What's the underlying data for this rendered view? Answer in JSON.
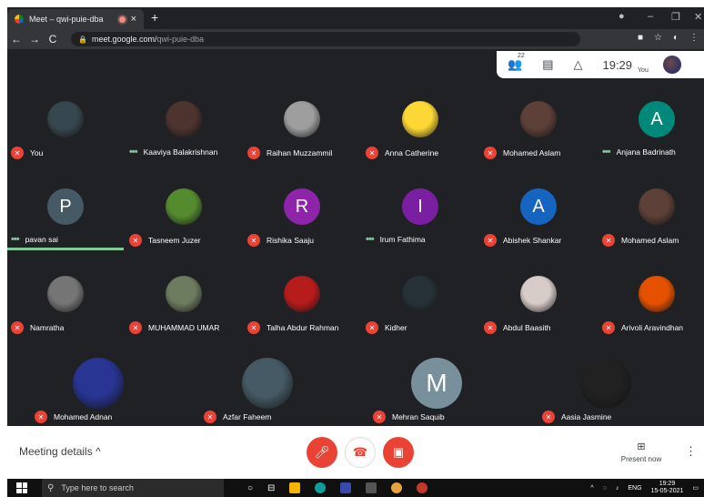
{
  "browser": {
    "tab_title": "Meet – qwi-puie-dba",
    "tab_close": "×",
    "new_tab": "+",
    "url_host": "meet.google.com/",
    "url_path": "qwi-puie-dba",
    "back": "←",
    "forward": "→",
    "reload": "C",
    "minimize": "–",
    "restore": "❐",
    "close": "✕"
  },
  "meet": {
    "participants_count": "22",
    "time": "19:29",
    "you_label": "You",
    "participants": [
      {
        "name": "You",
        "status": "muted",
        "kind": "photo",
        "color": "#37474f"
      },
      {
        "name": "Kaaviya Balakrishnan",
        "status": "speaking",
        "kind": "photo",
        "color": "#4e342e"
      },
      {
        "name": "Raihan Muzzammil",
        "status": "muted",
        "kind": "photo",
        "color": "#9e9e9e"
      },
      {
        "name": "Anna Catherine",
        "status": "muted",
        "kind": "photo",
        "color": "#fdd835"
      },
      {
        "name": "Mohamed Aslam",
        "status": "muted",
        "kind": "photo",
        "color": "#5d4037"
      },
      {
        "name": "Anjana Badrinath",
        "status": "speaking",
        "kind": "letter",
        "letter": "A",
        "color": "#00897b"
      },
      {
        "name": "pavan sai",
        "status": "speaking",
        "kind": "letter",
        "letter": "P",
        "color": "#455a64"
      },
      {
        "name": "Tasneem Juzer",
        "status": "muted",
        "kind": "photo",
        "color": "#558b2f"
      },
      {
        "name": "Rishika Saaju",
        "status": "muted",
        "kind": "letter",
        "letter": "R",
        "color": "#8e24aa"
      },
      {
        "name": "Irum Fathima",
        "status": "speaking",
        "kind": "letter",
        "letter": "I",
        "color": "#7b1fa2"
      },
      {
        "name": "Abishek Shankar",
        "status": "muted",
        "kind": "letter",
        "letter": "A",
        "color": "#1565c0"
      },
      {
        "name": "Mohamed Aslam",
        "status": "muted",
        "kind": "photo",
        "color": "#5d4037"
      },
      {
        "name": "Namratha",
        "status": "muted",
        "kind": "photo",
        "color": "#757575"
      },
      {
        "name": "MUHAMMAD UMAR",
        "status": "muted",
        "kind": "photo",
        "color": "#6d7b5f"
      },
      {
        "name": "Talha Abdur Rahman",
        "status": "muted",
        "kind": "photo",
        "color": "#b71c1c"
      },
      {
        "name": "Kidher",
        "status": "muted",
        "kind": "photo",
        "color": "#263238"
      },
      {
        "name": "Abdul Baasith",
        "status": "muted",
        "kind": "photo",
        "color": "#d7ccc8"
      },
      {
        "name": "Arivoli Aravindhan",
        "status": "muted",
        "kind": "photo",
        "color": "#e65100"
      },
      {
        "name": "Mohamed Adnan",
        "status": "muted",
        "kind": "photo",
        "color": "#283593"
      },
      {
        "name": "Azfar Faheem",
        "status": "muted",
        "kind": "photo",
        "color": "#455a64"
      },
      {
        "name": "Mehran Saquib",
        "status": "muted",
        "kind": "letter",
        "letter": "M",
        "color": "#78909c"
      },
      {
        "name": "Aasia Jasmine",
        "status": "muted",
        "kind": "photo",
        "color": "#212121"
      }
    ]
  },
  "controls": {
    "meeting_details": "Meeting details",
    "present_now": "Present now",
    "mic_icon": "mic-off-icon",
    "hangup_icon": "call-end-icon",
    "camera_icon": "videocam-off-icon"
  },
  "taskbar": {
    "search_placeholder": "Type here to search",
    "lang": "ENG",
    "time": "19:29",
    "date": "15-05-2021"
  }
}
